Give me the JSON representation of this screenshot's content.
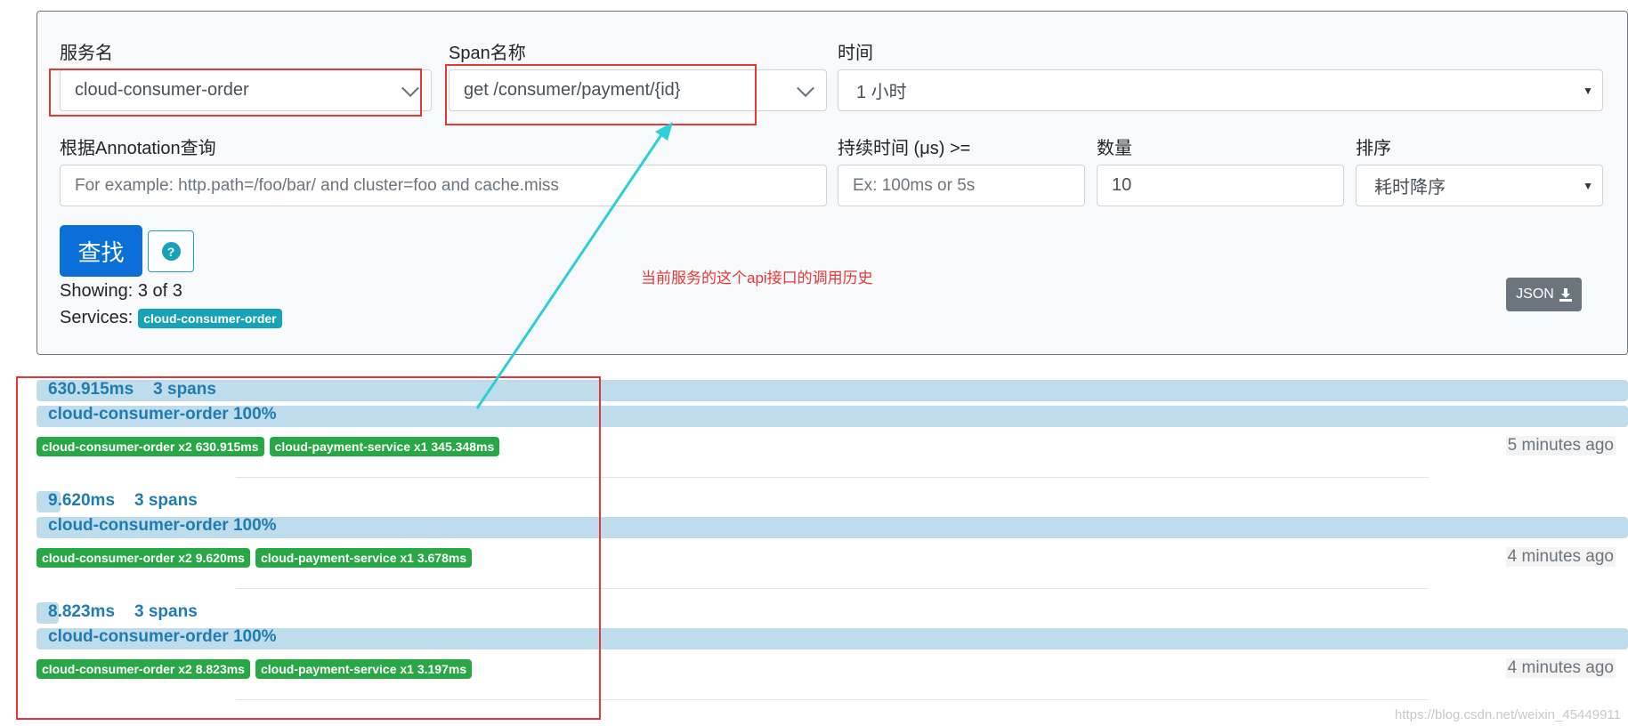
{
  "form": {
    "service_label": "服务名",
    "service_value": "cloud-consumer-order",
    "span_label": "Span名称",
    "span_value": "get /consumer/payment/{id}",
    "time_label": "时间",
    "time_value": "1 小时",
    "annotation_label": "根据Annotation查询",
    "annotation_placeholder": "For example: http.path=/foo/bar/ and cluster=foo and cache.miss",
    "duration_label": "持续时间 (μs) >=",
    "duration_placeholder": "Ex: 100ms or 5s",
    "limit_label": "数量",
    "limit_value": "10",
    "sort_label": "排序",
    "sort_value": "耗时降序",
    "search_button": "查找",
    "help_icon_glyph": "?",
    "showing_text": "Showing: 3 of 3",
    "services_label": "Services:",
    "services_badge": "cloud-consumer-order",
    "json_button": "JSON"
  },
  "annotation_note": "当前服务的这个api接口的调用历史",
  "traces": [
    {
      "duration": "630.915ms",
      "spans": "3 spans",
      "service_line": "cloud-consumer-order 100%",
      "duration_bar_fraction": 1.0,
      "chips": [
        "cloud-consumer-order x2 630.915ms",
        "cloud-payment-service x1 345.348ms"
      ],
      "time_ago": "5 minutes ago"
    },
    {
      "duration": "9.620ms",
      "spans": "3 spans",
      "service_line": "cloud-consumer-order 100%",
      "duration_bar_fraction": 0.015,
      "chips": [
        "cloud-consumer-order x2 9.620ms",
        "cloud-payment-service x1 3.678ms"
      ],
      "time_ago": "4 minutes ago"
    },
    {
      "duration": "8.823ms",
      "spans": "3 spans",
      "service_line": "cloud-consumer-order 100%",
      "duration_bar_fraction": 0.014,
      "chips": [
        "cloud-consumer-order x2 8.823ms",
        "cloud-payment-service x1 3.197ms"
      ],
      "time_ago": "4 minutes ago"
    }
  ],
  "watermark": "https://blog.csdn.net/weixin_45449911",
  "colors": {
    "primary": "#0a6fd8",
    "info": "#17a2b8",
    "success": "#28a745",
    "annotation_red": "#e53935",
    "arrow_cyan": "#2ad0d8",
    "bar_blue": "#bfdcec"
  }
}
